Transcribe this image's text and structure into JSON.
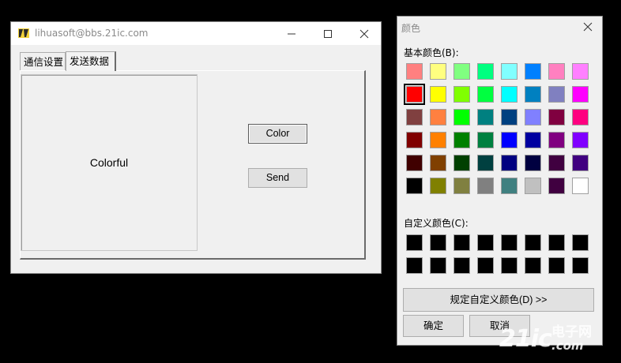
{
  "main_window": {
    "title": "lihuasoft@bbs.21ic.com",
    "tabs": [
      {
        "label": "通信设置"
      },
      {
        "label": "发送数据"
      }
    ],
    "panel_text": "Colorful",
    "color_button": "Color",
    "send_button": "Send"
  },
  "color_dialog": {
    "title": "颜色",
    "basic_label": "基本颜色(B):",
    "custom_label": "自定义颜色(C):",
    "define_button": "规定自定义颜色(D) >>",
    "ok_button": "确定",
    "cancel_button": "取消",
    "selected_color": "#ff0000",
    "basic_colors": [
      "#ff8080",
      "#ffff80",
      "#80ff80",
      "#00ff80",
      "#80ffff",
      "#0080ff",
      "#ff80c0",
      "#ff80ff",
      "#ff0000",
      "#ffff00",
      "#80ff00",
      "#00ff40",
      "#00ffff",
      "#0080c0",
      "#8080c0",
      "#ff00ff",
      "#804040",
      "#ff8040",
      "#00ff00",
      "#008080",
      "#004080",
      "#8080ff",
      "#800040",
      "#ff0080",
      "#800000",
      "#ff8000",
      "#008000",
      "#008040",
      "#0000ff",
      "#0000a0",
      "#800080",
      "#8000ff",
      "#400000",
      "#804000",
      "#004000",
      "#004040",
      "#000080",
      "#000040",
      "#400040",
      "#400080",
      "#000000",
      "#808000",
      "#808040",
      "#808080",
      "#408080",
      "#c0c0c0",
      "#400040",
      "#ffffff"
    ],
    "custom_colors": [
      "#000000",
      "#000000",
      "#000000",
      "#000000",
      "#000000",
      "#000000",
      "#000000",
      "#000000",
      "#000000",
      "#000000",
      "#000000",
      "#000000",
      "#000000",
      "#000000",
      "#000000",
      "#000000"
    ]
  },
  "watermark": {
    "brand": "21ic",
    "suffix": "电子网",
    "domain": ".com"
  }
}
